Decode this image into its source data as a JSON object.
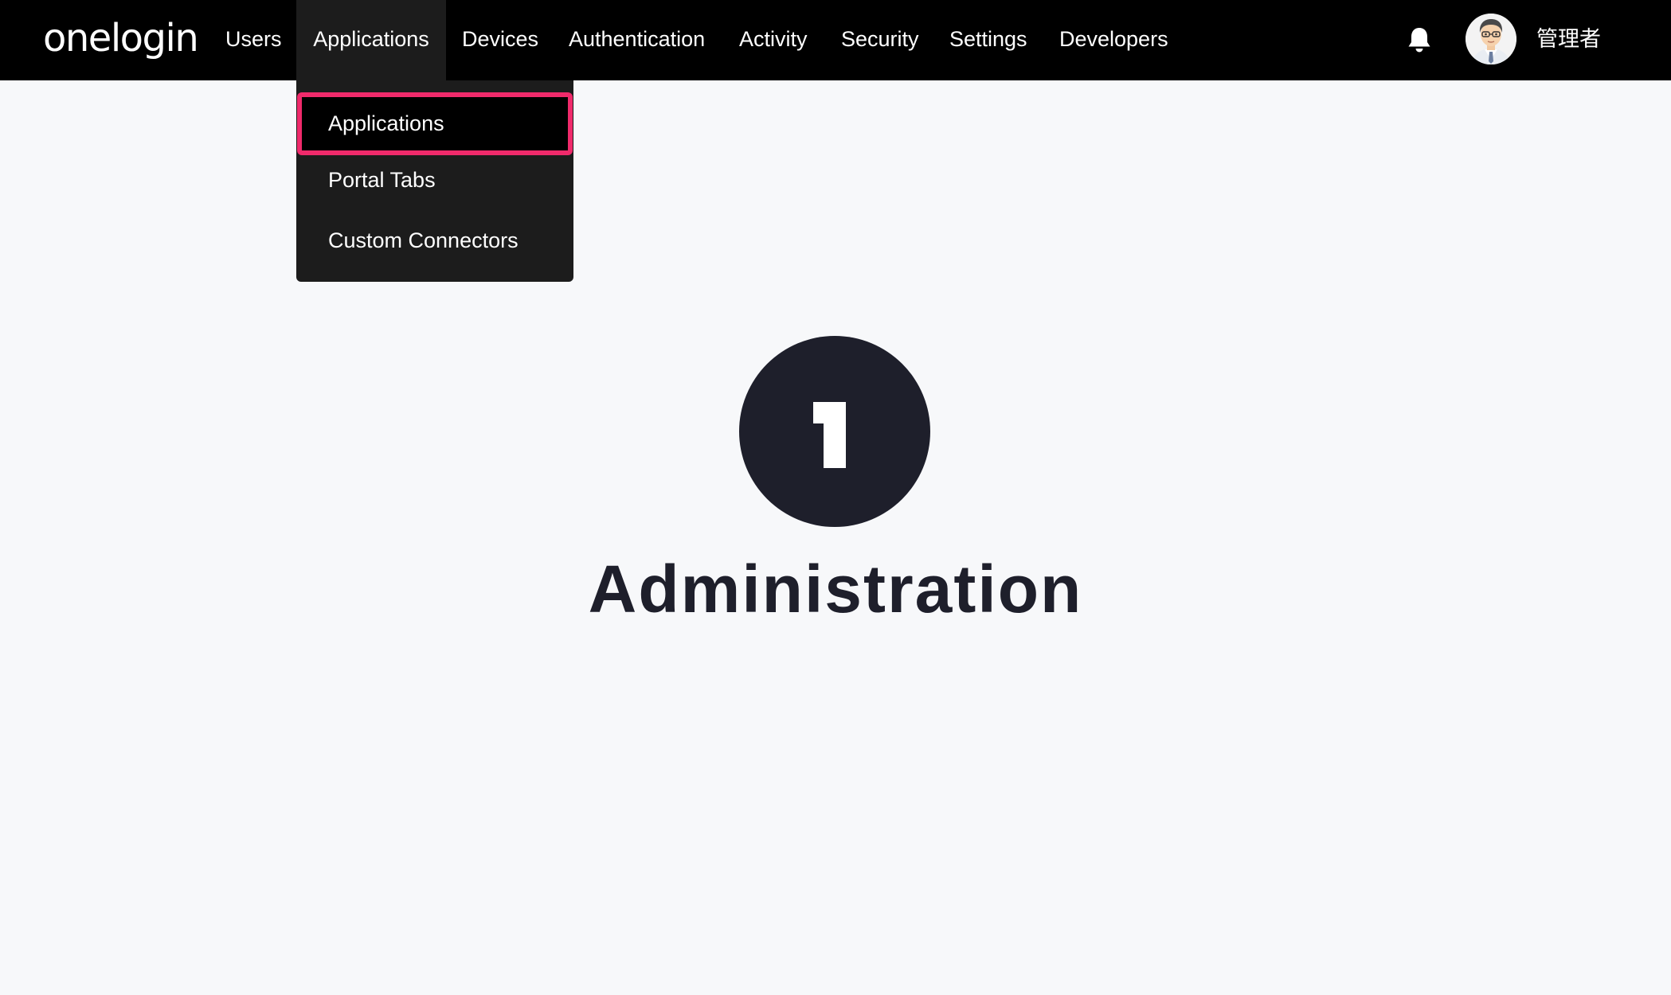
{
  "app": {
    "logo_text": "onelogin",
    "user_name": "管理者"
  },
  "nav": {
    "items": [
      {
        "label": "Users"
      },
      {
        "label": "Applications",
        "active": true
      },
      {
        "label": "Devices"
      },
      {
        "label": "Authentication"
      },
      {
        "label": "Activity"
      },
      {
        "label": "Security"
      },
      {
        "label": "Settings"
      },
      {
        "label": "Developers"
      }
    ]
  },
  "dropdown": {
    "items": [
      {
        "label": "Applications",
        "highlighted": true
      },
      {
        "label": "Portal Tabs"
      },
      {
        "label": "Custom Connectors"
      }
    ]
  },
  "main": {
    "heading": "Administration"
  },
  "icons": {
    "notifications": "bell-icon",
    "avatar": "avatar",
    "badge": "number-one-badge-icon"
  },
  "colors": {
    "topbar_bg": "#000000",
    "dropdown_bg": "#1c1c1c",
    "highlight_border": "#f02a6b",
    "page_bg": "#f7f8fa",
    "heading_color": "#1e1f2b"
  }
}
